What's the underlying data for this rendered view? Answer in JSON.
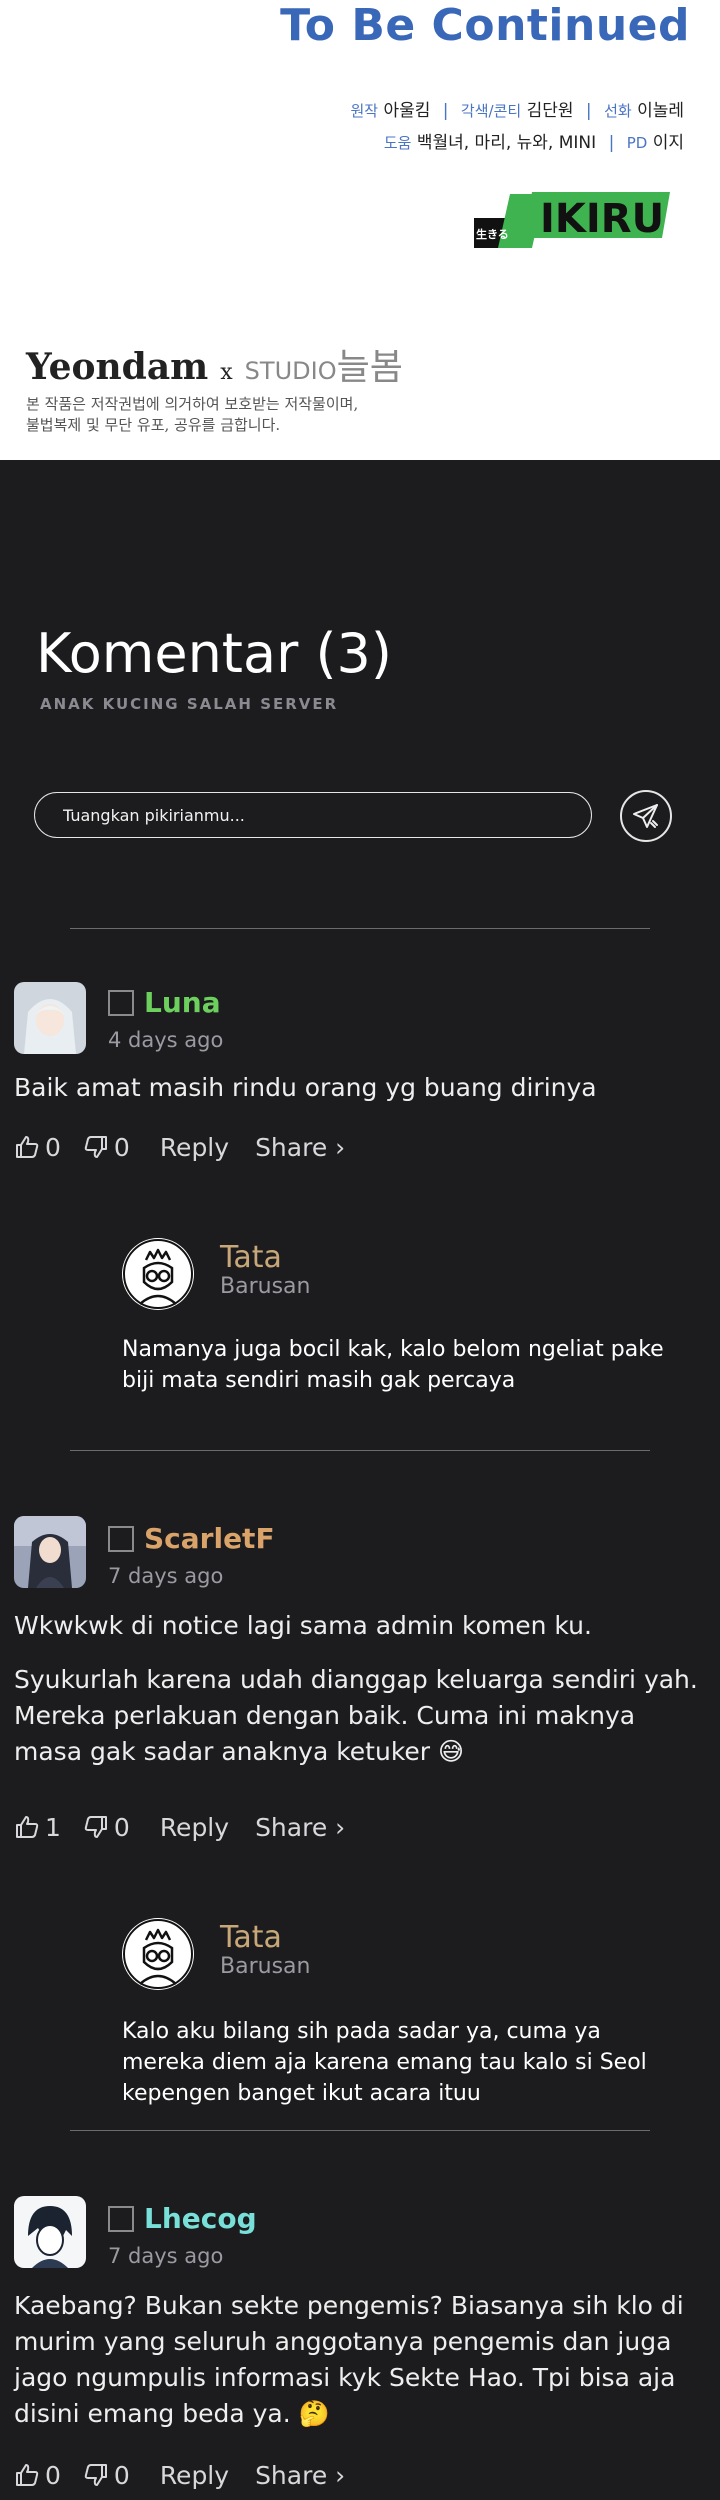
{
  "header": {
    "title": "To Be Continued",
    "credits_line1": [
      {
        "label": "원작",
        "value": "아울킴"
      },
      {
        "label": "각색/콘티",
        "value": "김단원"
      },
      {
        "label": "선화",
        "value": "이놀레"
      }
    ],
    "credits_line2_label": "도움",
    "credits_line2_value": "백월녀, 마리, 뉴와, MINI",
    "credits_line2_pd_label": "PD",
    "credits_line2_pd_value": "이지",
    "logo_small": "生きる",
    "logo_text": "IKIRU",
    "studio_left": "Yeondam",
    "studio_x": "x",
    "studio_mid": "STUDIO",
    "studio_right": "늘봄",
    "notice_line1": "본 작품은 저작권법에 의거하여 보호받는 저작물이며,",
    "notice_line2": "불법복제 및 무단 유포, 공유를 금합니다."
  },
  "comments_section": {
    "title": "Komentar (3)",
    "subtitle": "ANAK KUCING SALAH SERVER",
    "input_placeholder": "Tuangkan pikirianmu...",
    "send_icon": "send-paper-plane-icon"
  },
  "comments": [
    {
      "username": "Luna",
      "name_color": "#6ccf5e",
      "time": "4 days ago",
      "paragraphs": [
        "Baik amat masih rindu orang yg buang dirinya"
      ],
      "likes": "0",
      "dislikes": "0",
      "reply_label": "Reply",
      "share_label": "Share ›",
      "reply": {
        "name": "Tata",
        "time": "Barusan",
        "text": "Namanya juga bocil kak, kalo belom ngeliat pake biji mata sendiri masih gak percaya"
      }
    },
    {
      "username": "ScarletF",
      "name_color": "#d9a36a",
      "time": "7 days ago",
      "paragraphs": [
        "Wkwkwk di notice lagi sama admin komen ku.",
        "Syukurlah karena udah dianggap keluarga sendiri yah. Mereka perlakuan dengan baik. Cuma ini maknya masa gak sadar anaknya ketuker 😅"
      ],
      "likes": "1",
      "dislikes": "0",
      "reply_label": "Reply",
      "share_label": "Share ›",
      "reply": {
        "name": "Tata",
        "time": "Barusan",
        "text": "Kalo aku bilang sih pada sadar ya, cuma ya mereka diem aja karena emang tau kalo si Seol kepengen banget ikut acara ituu"
      }
    },
    {
      "username": "Lhecog",
      "name_color": "#78e0d8",
      "time": "7 days ago",
      "paragraphs": [
        "Kaebang? Bukan sekte pengemis? Biasanya sih klo di murim yang seluruh anggotanya pengemis dan juga jago ngumpulis informasi kyk Sekte Hao. Tpi bisa aja disini emang beda ya. 🤔"
      ],
      "likes": "0",
      "dislikes": "0",
      "reply_label": "Reply",
      "share_label": "Share ›"
    }
  ]
}
